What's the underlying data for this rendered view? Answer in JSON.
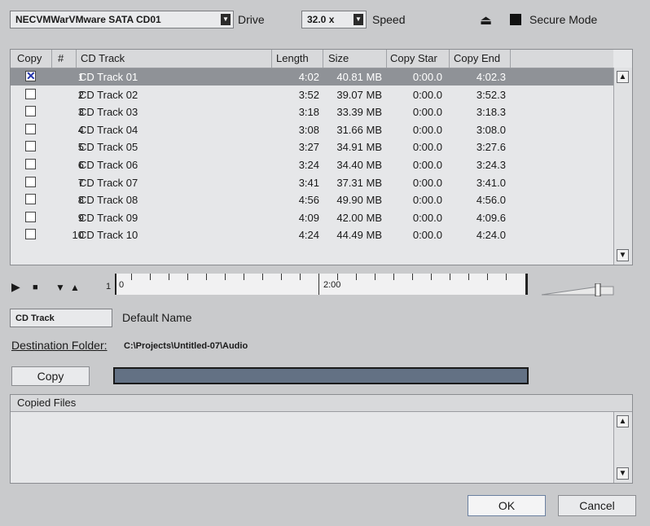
{
  "drive": {
    "value": "NECVMWarVMware SATA CD01",
    "label": "Drive"
  },
  "speed": {
    "value": "32.0 x",
    "label": "Speed"
  },
  "secure_mode": {
    "label": "Secure Mode"
  },
  "table": {
    "headers": [
      "Copy",
      "#",
      "CD Track",
      "Length",
      "Size",
      "Copy Star",
      "Copy End"
    ],
    "rows": [
      {
        "checked": true,
        "num": "1",
        "name": "CD Track 01",
        "length": "4:02",
        "size": "40.81 MB",
        "start": "0:00.0",
        "end": "4:02.3"
      },
      {
        "checked": false,
        "num": "2",
        "name": "CD Track 02",
        "length": "3:52",
        "size": "39.07 MB",
        "start": "0:00.0",
        "end": "3:52.3"
      },
      {
        "checked": false,
        "num": "3",
        "name": "CD Track 03",
        "length": "3:18",
        "size": "33.39 MB",
        "start": "0:00.0",
        "end": "3:18.3"
      },
      {
        "checked": false,
        "num": "4",
        "name": "CD Track 04",
        "length": "3:08",
        "size": "31.66 MB",
        "start": "0:00.0",
        "end": "3:08.0"
      },
      {
        "checked": false,
        "num": "5",
        "name": "CD Track 05",
        "length": "3:27",
        "size": "34.91 MB",
        "start": "0:00.0",
        "end": "3:27.6"
      },
      {
        "checked": false,
        "num": "6",
        "name": "CD Track 06",
        "length": "3:24",
        "size": "34.40 MB",
        "start": "0:00.0",
        "end": "3:24.3"
      },
      {
        "checked": false,
        "num": "7",
        "name": "CD Track 07",
        "length": "3:41",
        "size": "37.31 MB",
        "start": "0:00.0",
        "end": "3:41.0"
      },
      {
        "checked": false,
        "num": "8",
        "name": "CD Track 08",
        "length": "4:56",
        "size": "49.90 MB",
        "start": "0:00.0",
        "end": "4:56.0"
      },
      {
        "checked": false,
        "num": "9",
        "name": "CD Track 09",
        "length": "4:09",
        "size": "42.00 MB",
        "start": "0:00.0",
        "end": "4:09.6"
      },
      {
        "checked": false,
        "num": "10",
        "name": "CD Track 10",
        "length": "4:24",
        "size": "44.49 MB",
        "start": "0:00.0",
        "end": "4:24.0"
      }
    ]
  },
  "ruler": {
    "start_label": "0",
    "mid_label": "2:00",
    "left_marker": "1"
  },
  "naming": {
    "field_value": "CD Track",
    "label": "Default Name"
  },
  "destination": {
    "label": "Destination Folder:",
    "path": "C:\\Projects\\Untitled-07\\Audio"
  },
  "copy_button": "Copy",
  "copied_files": {
    "header": "Copied Files"
  },
  "ok_button": "OK",
  "cancel_button": "Cancel",
  "colors": {
    "selected_row": "#8f9297",
    "progress_fill": "#637184",
    "dialog_bg": "#c9cacc"
  }
}
